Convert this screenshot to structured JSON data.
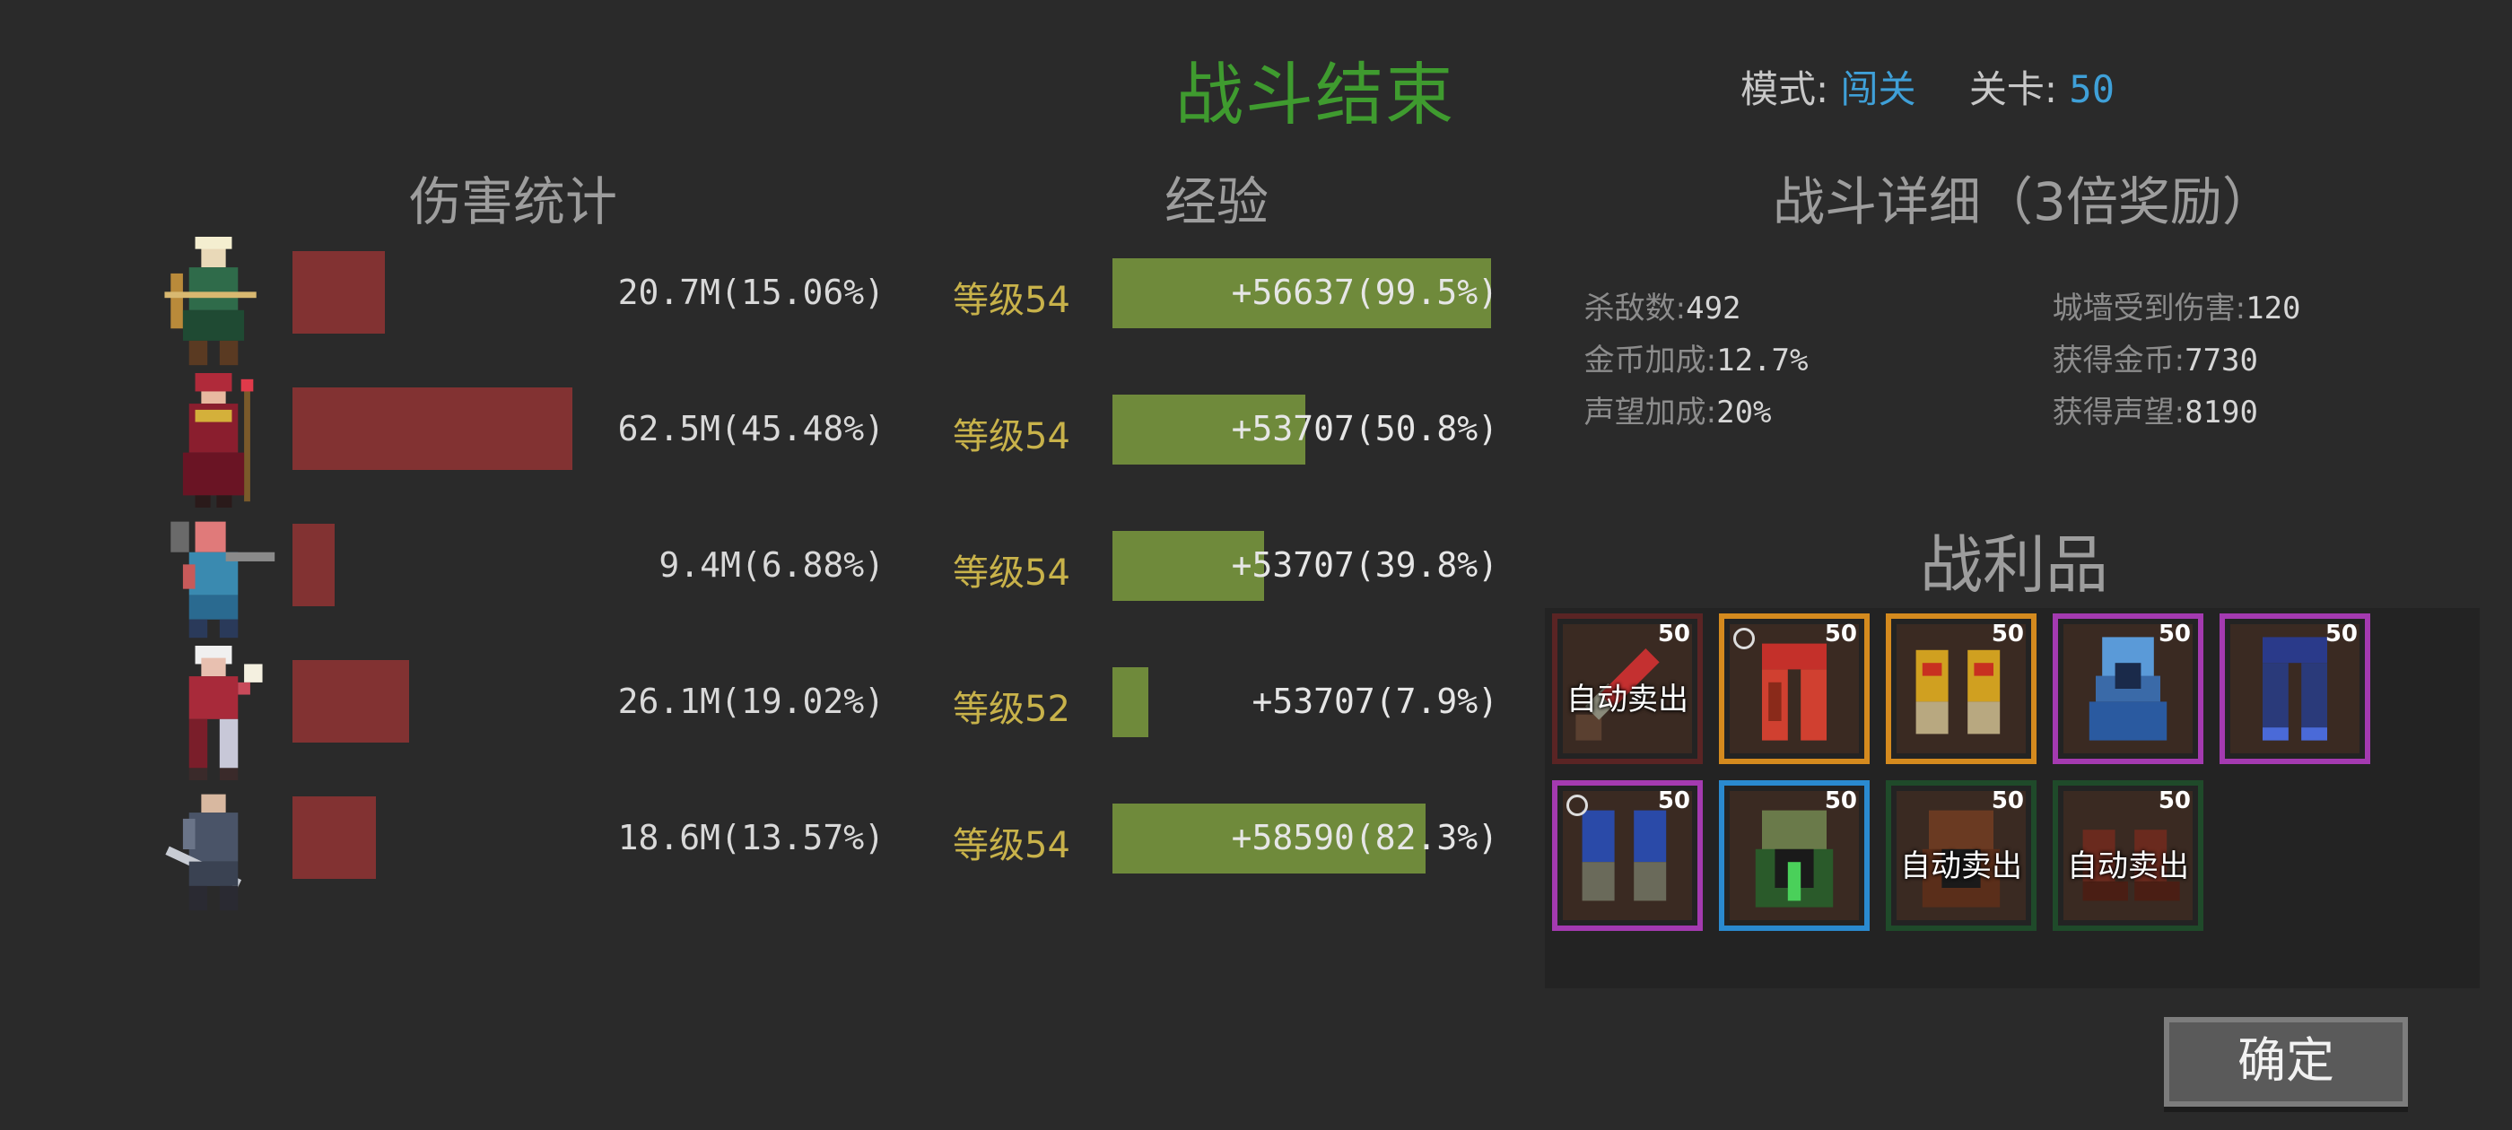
{
  "header": {
    "title": "战斗结束",
    "mode_label": "模式:",
    "mode_value": "闯关",
    "stage_label": "关卡:",
    "stage_value": "50"
  },
  "damage": {
    "heading": "伤害统计",
    "rows": [
      {
        "hero": "elf-archer",
        "text": "20.7M(15.06%)",
        "share": 15.06
      },
      {
        "hero": "red-mage",
        "text": "62.5M(45.48%)",
        "share": 45.48
      },
      {
        "hero": "gunner",
        "text": "9.4M(6.88%)",
        "share": 6.88
      },
      {
        "hero": "white-haired-mage",
        "text": "26.1M(19.02%)",
        "share": 19.02
      },
      {
        "hero": "swordsman",
        "text": "18.6M(13.57%)",
        "share": 13.57
      }
    ]
  },
  "xp": {
    "heading": "经验",
    "rows": [
      {
        "level": "等级54",
        "text": "+56637(99.5%)",
        "progress": 99.5
      },
      {
        "level": "等级54",
        "text": "+53707(50.8%)",
        "progress": 50.8
      },
      {
        "level": "等级54",
        "text": "+53707(39.8%)",
        "progress": 39.8
      },
      {
        "level": "等级52",
        "text": "+53707(7.9%)",
        "progress": 7.9
      },
      {
        "level": "等级54",
        "text": "+58590(82.3%)",
        "progress": 82.3
      }
    ]
  },
  "details": {
    "heading": "战斗详细（3倍奖励）",
    "kills_label": "杀敌数:",
    "kills": "492",
    "wall_label": "城墙受到伤害:",
    "wall": "120",
    "gold_bonus_label": "金币加成:",
    "gold_bonus": "12.7%",
    "gold_label": "获得金币:",
    "gold": "7730",
    "rep_bonus_label": "声望加成:",
    "rep_bonus": "20%",
    "rep_label": "获得声望:",
    "rep": "8190"
  },
  "loot": {
    "heading": "战利品",
    "auto_sell_label": "自动卖出",
    "items": [
      {
        "icon": "dagger-icon",
        "level": "50",
        "rarity_color": "#5a2424",
        "auto_sell": true,
        "marked": false
      },
      {
        "icon": "red-pants-icon",
        "level": "50",
        "rarity_color": "#d48a1e",
        "auto_sell": false,
        "marked": true
      },
      {
        "icon": "gauntlets-icon",
        "level": "50",
        "rarity_color": "#d48a1e",
        "auto_sell": false,
        "marked": false
      },
      {
        "icon": "blue-helmet-icon",
        "level": "50",
        "rarity_color": "#a43ab0",
        "auto_sell": false,
        "marked": false
      },
      {
        "icon": "blue-leggings-icon",
        "level": "50",
        "rarity_color": "#a43ab0",
        "auto_sell": false,
        "marked": false
      },
      {
        "icon": "blue-gloves-icon",
        "level": "50",
        "rarity_color": "#a43ab0",
        "auto_sell": false,
        "marked": true
      },
      {
        "icon": "green-hood-icon",
        "level": "50",
        "rarity_color": "#2a8ad0",
        "auto_sell": false,
        "marked": false
      },
      {
        "icon": "leather-hood-icon",
        "level": "50",
        "rarity_color": "#1f4a2a",
        "auto_sell": true,
        "marked": false
      },
      {
        "icon": "boots-icon",
        "level": "50",
        "rarity_color": "#1f4a2a",
        "auto_sell": true,
        "marked": false
      }
    ]
  },
  "confirm_label": "确定"
}
